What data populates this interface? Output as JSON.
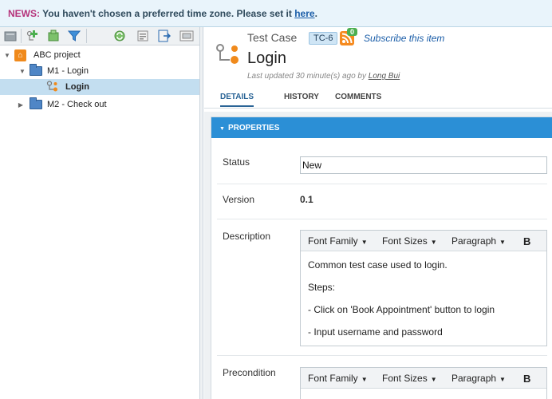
{
  "news": {
    "tag": "NEWS:",
    "message": "You haven't chosen a preferred time zone. Please set it",
    "link": "here",
    "end": "."
  },
  "toolbar": {
    "icons": [
      "add-icon",
      "add-child-icon",
      "clone-icon",
      "filter-icon",
      "sync-icon",
      "export-icon",
      "import-icon",
      "view-icon"
    ]
  },
  "tree": {
    "project": "ABC project",
    "module1": "M1 - Login",
    "testcase": "Login",
    "module2": "M2 - Check out"
  },
  "header": {
    "type": "Test Case",
    "id": "TC-6",
    "subscriber_count": "0",
    "subscribe": "Subscribe this item",
    "title": "Login",
    "updated_prefix": "Last updated 30 minute(s) ago by",
    "updated_by": "Long Bui"
  },
  "tabs": {
    "details": "DETAILS",
    "history": "HISTORY",
    "comments": "COMMENTS"
  },
  "properties": {
    "header": "PROPERTIES",
    "status_label": "Status",
    "status_value": "New",
    "version_label": "Version",
    "version_value": "0.1",
    "description_label": "Description",
    "precondition_label": "Precondition",
    "editor": {
      "font_family": "Font Family",
      "font_sizes": "Font Sizes",
      "paragraph": "Paragraph",
      "bold": "B"
    },
    "description_lines": [
      "Common test case used to login.",
      "Steps:",
      "- Click on 'Book Appointment' button to login",
      "- Input username and password"
    ]
  },
  "colors": {
    "accent": "#2b8fd6",
    "news_bg": "#e9f4fb",
    "selected_row": "#c3def0",
    "tag": "#b5327a"
  }
}
